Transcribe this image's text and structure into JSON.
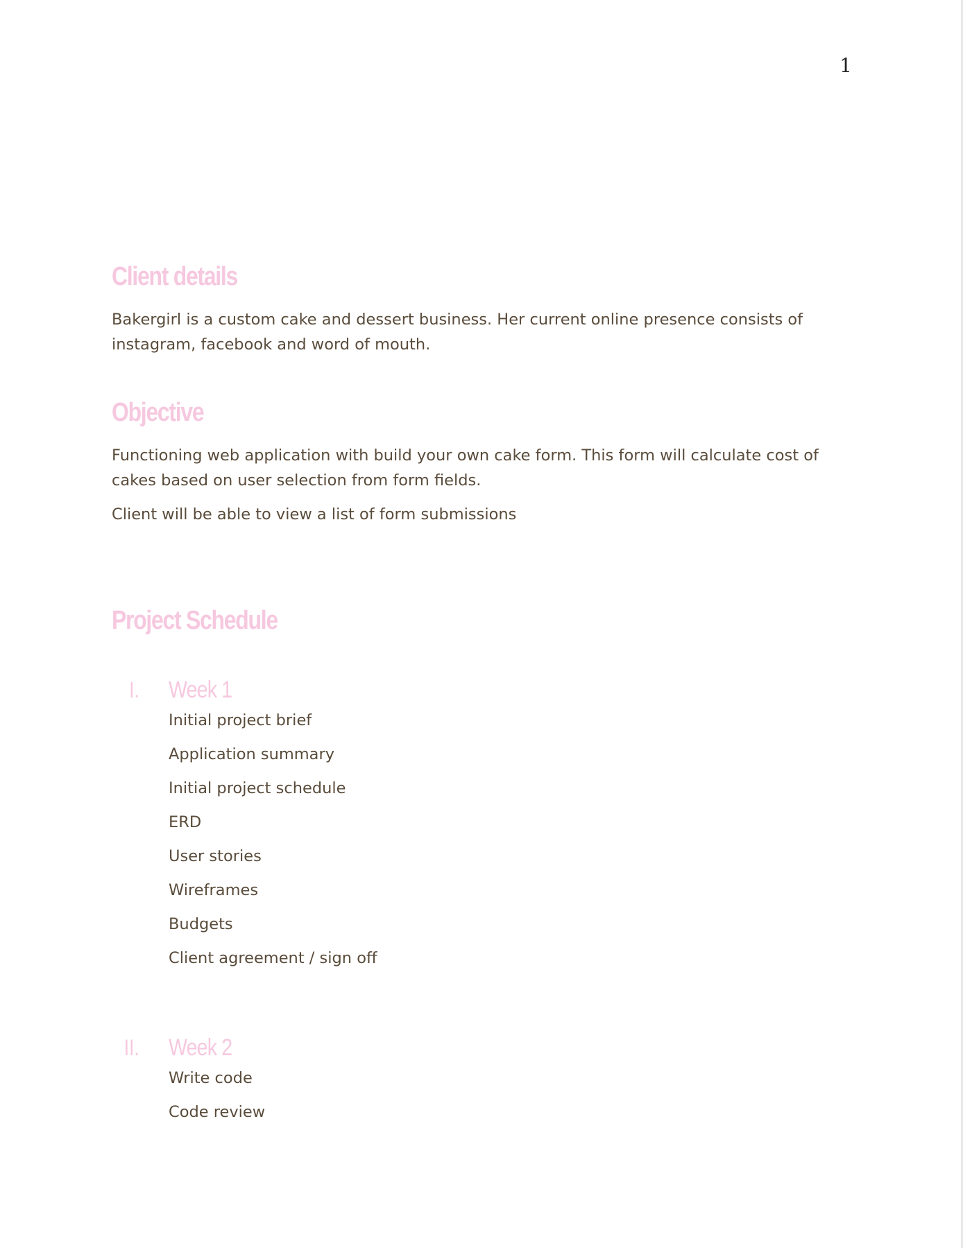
{
  "page_number": "1",
  "sections": {
    "client": {
      "heading": "Client details",
      "paragraph": "Bakergirl is a custom cake and dessert business. Her current online presence consists of instagram, facebook and word of mouth."
    },
    "objective": {
      "heading": "Objective",
      "paragraphs": [
        "Functioning web application with build your own cake form. This form will calculate cost of cakes based on user selection from form fields.",
        "Client will be able to view a list of form submissions"
      ]
    },
    "schedule": {
      "heading": "Project Schedule",
      "weeks": [
        {
          "numeral": "I.",
          "title": "Week 1",
          "tasks": [
            "Initial project brief",
            "Application summary",
            "Initial project schedule",
            "ERD",
            "User stories",
            "Wireframes",
            "Budgets",
            "Client agreement / sign off"
          ]
        },
        {
          "numeral": "II.",
          "title": "Week 2",
          "tasks": [
            "Write code",
            "Code review"
          ]
        }
      ]
    }
  },
  "colors": {
    "heading": "#f6c8df",
    "body": "#5a4c3b"
  }
}
